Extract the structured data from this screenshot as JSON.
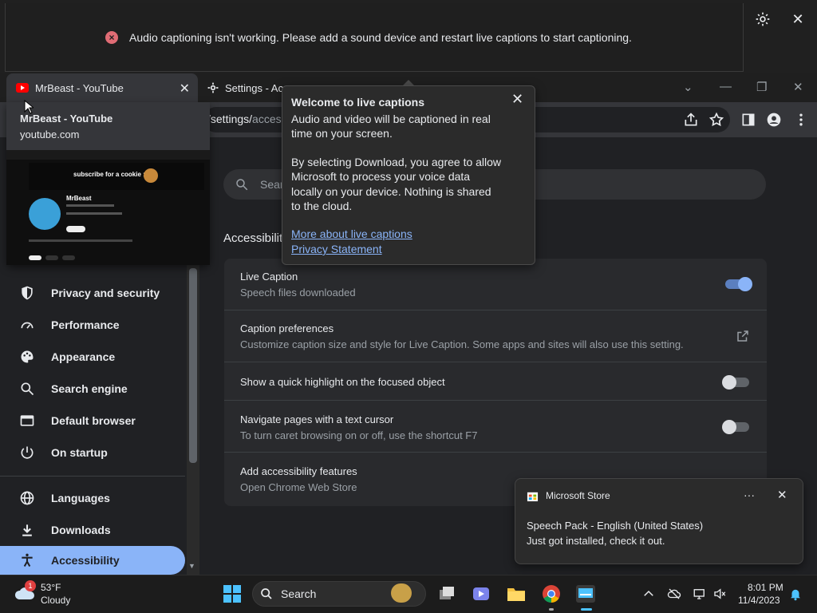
{
  "caption_bar": {
    "message": "Audio captioning isn't working. Please add a sound device and restart live captions to start captioning.",
    "error_icon": "×",
    "close_icon": "✕"
  },
  "tabs": [
    {
      "title": "MrBeast - YouTube",
      "icon": "youtube-icon"
    },
    {
      "title": "Settings - Acc",
      "icon": "gear-icon"
    }
  ],
  "window_controls": {
    "dropdown": "⌄",
    "minimize": "—",
    "maximize": "❐",
    "close": "✕"
  },
  "address_bar": {
    "url_prefix": "/settings/",
    "url_rest": "acces"
  },
  "tab_preview": {
    "title": "MrBeast - YouTube",
    "domain": "youtube.com",
    "thumb_banner": "subscribe for a cookie :)",
    "thumb_channel": "MrBeast"
  },
  "settings": {
    "search_placeholder": "Sear",
    "section_title": "Accessibility",
    "rows": [
      {
        "title": "Live Caption",
        "subtitle": "Speech files downloaded",
        "control": "toggle",
        "on": true
      },
      {
        "title": "Caption preferences",
        "subtitle": "Customize caption size and style for Live Caption. Some apps and sites will also use this setting.",
        "control": "external"
      },
      {
        "title": "Show a quick highlight on the focused object",
        "subtitle": "",
        "control": "toggle",
        "on": false
      },
      {
        "title": "Navigate pages with a text cursor",
        "subtitle": "To turn caret browsing on or off, use the shortcut F7",
        "control": "toggle",
        "on": false
      },
      {
        "title": "Add accessibility features",
        "subtitle": "Open Chrome Web Store",
        "control": "external"
      }
    ]
  },
  "sidebar": {
    "items": [
      {
        "label": "Privacy and security",
        "icon": "shield-icon"
      },
      {
        "label": "Performance",
        "icon": "speedometer-icon"
      },
      {
        "label": "Appearance",
        "icon": "palette-icon"
      },
      {
        "label": "Search engine",
        "icon": "search-icon"
      },
      {
        "label": "Default browser",
        "icon": "browser-icon"
      },
      {
        "label": "On startup",
        "icon": "power-icon"
      },
      {
        "label": "Languages",
        "icon": "globe-icon"
      },
      {
        "label": "Downloads",
        "icon": "download-icon"
      },
      {
        "label": "Accessibility",
        "icon": "accessibility-icon"
      }
    ]
  },
  "live_caption_popup": {
    "title": "Welcome to live captions",
    "lines": [
      "Audio and video will be captioned in real",
      "time on your screen.",
      "By selecting Download, you agree to allow",
      "Microsoft to process your voice data",
      "locally on your device. Nothing is shared",
      "to the cloud."
    ],
    "link_more": "More about live captions",
    "link_privacy": "Privacy Statement",
    "close_icon": "✕"
  },
  "toast": {
    "app": "Microsoft Store",
    "line1": "Speech Pack - English (United States)",
    "line2": "Just got installed, check it out.",
    "more": "···",
    "close": "✕"
  },
  "taskbar": {
    "weather_temp": "53°F",
    "weather_desc": "Cloudy",
    "weather_badge": "1",
    "search_label": "Search",
    "time": "8:01 PM",
    "date": "11/4/2023"
  },
  "colors": {
    "accent": "#8ab4f8",
    "background": "#202124",
    "card": "#292a2d",
    "error": "#e06c75"
  }
}
